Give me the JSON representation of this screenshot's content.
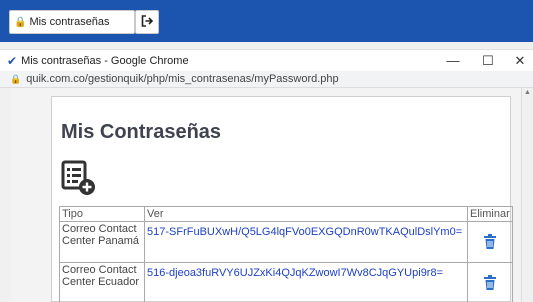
{
  "taskbar": {
    "password_button_label": "Mis contraseñas",
    "password_button_icon": "lock-icon",
    "logout_button_icon": "logout-icon"
  },
  "window": {
    "title": "Mis contraseñas - Google Chrome",
    "minimize": "—",
    "maximize": "☐",
    "close": "✕"
  },
  "address": {
    "url": "quik.com.co/gestionquik/php/mis_contrasenas/myPassword.php"
  },
  "page": {
    "title": "Mis Contraseñas",
    "add_icon": "add-document-icon"
  },
  "table": {
    "headers": [
      "Tipo",
      "Ver",
      "Eliminar"
    ],
    "rows": [
      {
        "tipo": "Correo Contact Center Panamá",
        "ver": "517-SFrFuBUXwH/Q5LG4lqFVo0EXGQDnR0wTKAQulDslYm0=",
        "delete_icon": "trash-icon"
      },
      {
        "tipo": "Correo Contact Center Ecuador",
        "ver": "516-djeoa3fuRVY6UJZxKi4QJqKZwowI7Wv8CJqGYUpi9r8=",
        "delete_icon": "trash-icon"
      }
    ]
  },
  "colors": {
    "topbar": "#1c55b0",
    "title_text": "#3f4350",
    "link_text": "#1c3fc4",
    "trash": "#2c6fc7"
  }
}
